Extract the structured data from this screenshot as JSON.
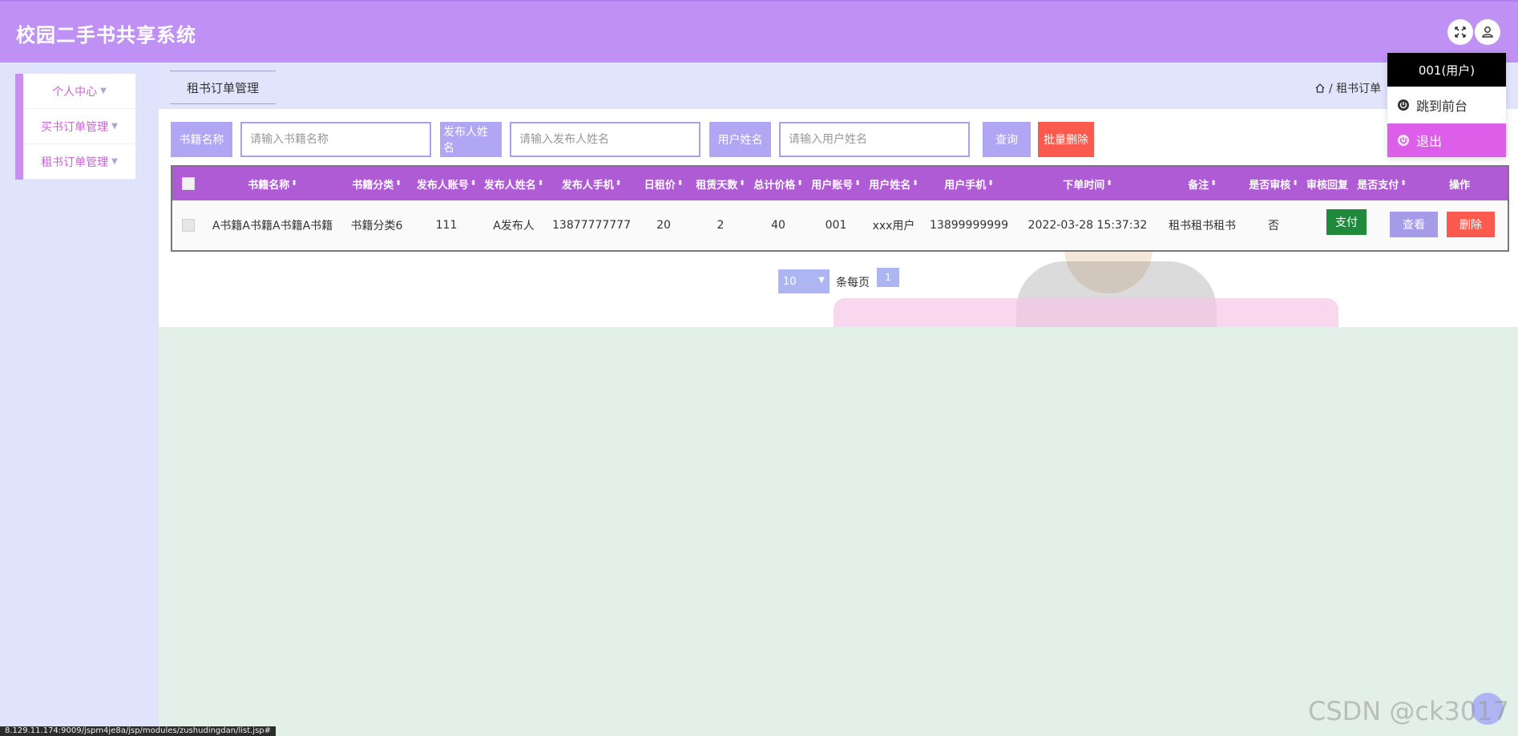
{
  "header": {
    "title": "校园二手书共享系统"
  },
  "sidebar": {
    "items": [
      {
        "label": "个人中心"
      },
      {
        "label": "买书订单管理"
      },
      {
        "label": "租书订单管理"
      }
    ]
  },
  "page": {
    "tab": "租书订单管理",
    "breadcrumb": "/ 租书订单"
  },
  "search": {
    "fields": [
      {
        "label": "书籍名称",
        "placeholder": "请输入书籍名称"
      },
      {
        "label": "发布人姓名",
        "placeholder": "请输入发布人姓名"
      },
      {
        "label": "用户姓名",
        "placeholder": "请输入用户姓名"
      }
    ],
    "query_label": "查询",
    "batch_delete_label": "批量删除"
  },
  "table": {
    "columns": [
      "书籍名称",
      "书籍分类",
      "发布人账号",
      "发布人姓名",
      "发布人手机",
      "日租价",
      "租赁天数",
      "总计价格",
      "用户账号",
      "用户姓名",
      "用户手机",
      "下单时间",
      "备注",
      "是否审核",
      "审核回复",
      "是否支付",
      "操作"
    ],
    "rows": [
      {
        "book_name": "A书籍A书籍A书籍A书籍",
        "category": "书籍分类6",
        "publisher_account": "111",
        "publisher_name": "A发布人",
        "publisher_phone": "13877777777",
        "daily_price": "20",
        "days": "2",
        "total": "40",
        "user_account": "001",
        "user_name": "xxx用户",
        "user_phone": "13899999999",
        "order_time": "2022-03-28 15:37:32",
        "remark": "租书租书租书",
        "audited": "否",
        "audit_reply": "",
        "pay_label": "支付",
        "view_label": "查看",
        "delete_label": "删除"
      }
    ]
  },
  "pagination": {
    "page_size": "10",
    "per_page_text": "条每页",
    "current_page": "1"
  },
  "user_menu": {
    "user": "001(用户)",
    "goto_front": "跳到前台",
    "logout": "退出"
  },
  "status_url": "8.129.11.174:9009/jspm4je8a/jsp/modules/zushudingdan/list.jsp#",
  "watermark": "CSDN @ck3017",
  "colors": {
    "header": "#c091f4",
    "table_header": "#b05bd6",
    "pay": "#1f8a3b",
    "delete": "#fb5a4e",
    "view": "#a59be6"
  }
}
